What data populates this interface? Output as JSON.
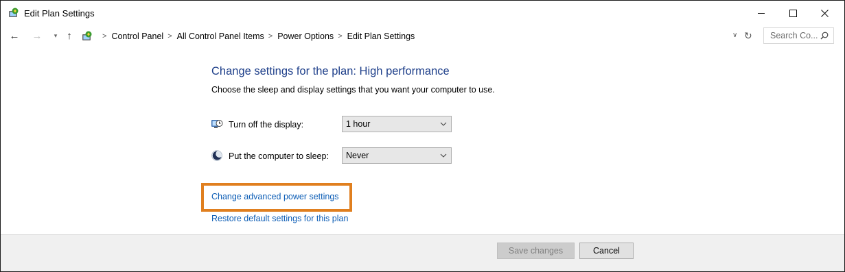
{
  "window": {
    "title": "Edit Plan Settings",
    "controls": {
      "minimize": "minimize",
      "maximize": "maximize",
      "close": "close"
    }
  },
  "nav": {
    "breadcrumbs": [
      "Control Panel",
      "All Control Panel Items",
      "Power Options",
      "Edit Plan Settings"
    ],
    "search_placeholder": "Search Co..."
  },
  "main": {
    "heading": "Change settings for the plan: High performance",
    "subtext": "Choose the sleep and display settings that you want your computer to use.",
    "settings": [
      {
        "label": "Turn off the display:",
        "value": "1 hour",
        "icon": "display-timer-icon"
      },
      {
        "label": "Put the computer to sleep:",
        "value": "Never",
        "icon": "sleep-moon-icon"
      }
    ],
    "links": {
      "advanced": "Change advanced power settings",
      "restore": "Restore default settings for this plan"
    },
    "highlight_color": "#e07f1f",
    "link_color": "#0b5cb5",
    "heading_color": "#1e3f8a"
  },
  "footer": {
    "save_label": "Save changes",
    "save_enabled": false,
    "cancel_label": "Cancel"
  }
}
